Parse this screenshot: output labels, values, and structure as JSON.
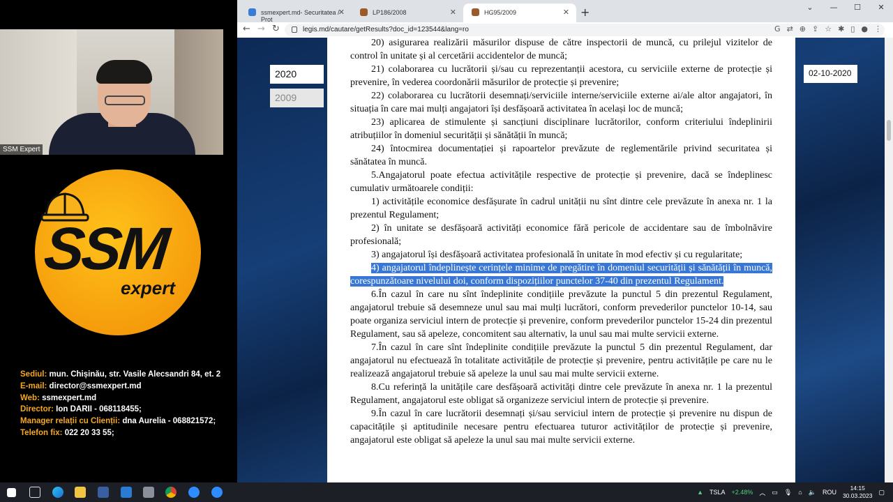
{
  "camera": {
    "label": "SSM Expert"
  },
  "logo": {
    "main": "SSM",
    "sub": "expert"
  },
  "contacts": [
    {
      "key": "Sediul:",
      "value": "mun. Chișinău, str. Vasile Alecsandri 84, et. 2"
    },
    {
      "key": "E-mail:",
      "value": "director@ssmexpert.md"
    },
    {
      "key": "Web:",
      "value": "ssmexpert.md"
    },
    {
      "key": "Director:",
      "value": "Ion DARII - 068118455;"
    },
    {
      "key": "Manager relații cu Clienții:",
      "value": "dna Aurelia - 068821572;"
    },
    {
      "key": "Telefon fix:",
      "value": "022 20 33 55;"
    }
  ],
  "browser": {
    "tabs": [
      {
        "title": "ssmexpert.md- Securitatea / Prot",
        "favicon_color": "#3b7bd8"
      },
      {
        "title": "LP186/2008",
        "favicon_color": "#9b5a2a"
      },
      {
        "title": "HG95/2009",
        "favicon_color": "#9b5a2a"
      }
    ],
    "url": "legis.md/cautare/getResults?doc_id=123544&lang=ro"
  },
  "sidebar": {
    "year_active": "2020",
    "year_inactive": "2009",
    "date": "02-10-2020"
  },
  "document": {
    "paragraphs": [
      "20) asigurarea realizării măsurilor dispuse de către inspectorii de muncă, cu prilejul vizitelor de control în unitate și al cercetării accidentelor de muncă;",
      "21) colaborarea cu lucrătorii și/sau cu reprezentanții acestora, cu serviciile externe de protecție și prevenire, în vederea coordonării măsurilor de protecție și prevenire;",
      "22) colaborarea cu lucrătorii desemnați/serviciile interne/serviciile externe ai/ale altor angajatori, în situația în care mai mulți angajatori își desfășoară activitatea în același loc de muncă;",
      "23) aplicarea de stimulente și sancțiuni disciplinare lucrătorilor, conform criteriului îndeplinirii atribuțiilor în domeniul securității și sănătății în muncă;",
      "24) întocmirea documentației și rapoartelor prevăzute de reglementările privind securitatea și sănătatea în muncă.",
      "5.Angajatorul poate efectua activitățile respective de protecție și prevenire, dacă se îndeplinesc cumulativ următoarele condiții:",
      "1) activitățile economice desfășurate în cadrul unității nu sînt dintre cele prevăzute în anexa nr. 1 la prezentul Regulament;",
      "2) în unitate se desfășoară activități economice fără pericole de accidentare sau de îmbolnăvire profesională;",
      "3) angajatorul își desfășoară activitatea profesională în unitate în mod efectiv și cu regularitate;"
    ],
    "highlighted": "4) angajatorul îndeplinește cerințele minime de pregătire în domeniul securității și sănătății în muncă, corespunzătoare nivelului doi, conform dispozițiilor punctelor 37-40 din prezentul Regulament.",
    "paragraphs_after": [
      "6.În cazul în care nu sînt îndeplinite condițiile prevăzute la punctul 5 din prezentul Regulament, angajatorul trebuie să desemneze unul sau mai mulți lucrători, conform prevederilor punctelor 10-14, sau poate organiza serviciul intern de protecție și prevenire, conform prevederilor punctelor 15-24 din prezentul Regulament, sau să apeleze, concomitent sau alternativ, la unul sau mai multe servicii externe.",
      "7.În cazul în care sînt îndeplinite condițiile prevăzute la punctul 5 din prezentul Regulament, dar angajatorul nu efectuează în totalitate activitățile de protecție și prevenire, pentru activitățile pe care nu le realizează angajatorul trebuie să apeleze la unul sau mai multe servicii externe.",
      "8.Cu referință la unitățile care desfășoară activități dintre cele prevăzute în anexa nr. 1 la prezentul Regulament, angajatorul este obligat să organizeze serviciul intern de protecție și prevenire.",
      "9.În cazul în care lucrătorii desemnați și/sau serviciul intern de protecție și prevenire nu dispun de capacitățile și aptitudinile necesare pentru efectuarea tuturor activităților de protecție și prevenire, angajatorul este obligat să apeleze la unul sau mai multe servicii externe."
    ]
  },
  "taskbar": {
    "stock": "TSLA",
    "stock_change": "+2.48%",
    "language": "ROU",
    "time": "14:15",
    "date": "30.03.2023"
  }
}
